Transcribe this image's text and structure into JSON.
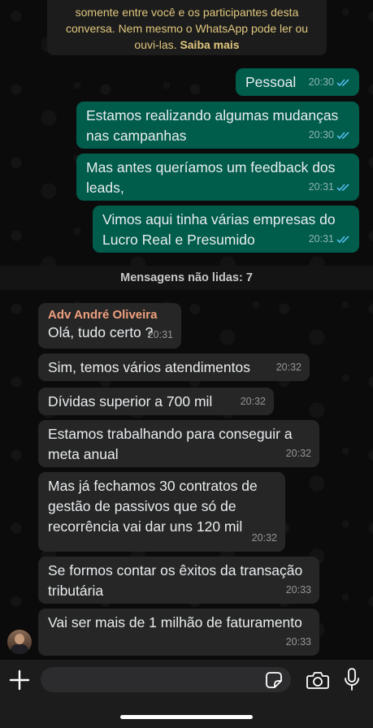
{
  "encryption_notice": {
    "line1": "somente entre você e os participantes desta",
    "line2": "conversa. Nem mesmo o WhatsApp pode ler ou",
    "line3_prefix": "ouvi-las.",
    "learn_more": "Saiba mais"
  },
  "outgoing": [
    {
      "lines": [
        "Pessoal"
      ],
      "time": "20:30"
    },
    {
      "lines": [
        "Estamos realizando algumas mudanças",
        "nas campanhas"
      ],
      "time": "20:30"
    },
    {
      "lines": [
        "Mas antes queríamos um feedback dos",
        "leads,"
      ],
      "time": "20:31"
    },
    {
      "lines": [
        "Vimos aqui tinha várias empresas do",
        "Lucro Real e Presumido"
      ],
      "time": "20:31"
    }
  ],
  "unread_divider": "Mensagens não lidas: 7",
  "incoming": [
    {
      "sender": "Adv André  Oliveira",
      "lines": [
        "Olá, tudo certo ?"
      ],
      "time": "20:31"
    },
    {
      "lines": [
        "Sim, temos vários atendimentos"
      ],
      "time": "20:32"
    },
    {
      "lines": [
        "Dívidas superior a 700 mil"
      ],
      "time": "20:32"
    },
    {
      "lines": [
        "Estamos trabalhando para conseguir a",
        "meta anual"
      ],
      "time": "20:32"
    },
    {
      "lines": [
        "Mas já fechamos 30 contratos de",
        "gestão de passivos que só de",
        "recorrência vai dar uns 120 mil"
      ],
      "time": "20:32"
    },
    {
      "lines": [
        "Se formos contar os êxitos da transação",
        "tributária"
      ],
      "time": "20:33"
    },
    {
      "lines": [
        "Vai ser mais de 1 milhão de faturamento"
      ],
      "time": "20:33"
    }
  ],
  "composer": {
    "input_value": ""
  },
  "colors": {
    "outgoing_bubble": "#005c4b",
    "incoming_bubble": "#262626",
    "sender_name": "#f0a07f",
    "read_ticks": "#53bdeb",
    "notice_text": "#e0c77e"
  },
  "icons": [
    "plus-icon",
    "sticker-icon",
    "camera-icon",
    "microphone-icon",
    "double-check-icon"
  ]
}
